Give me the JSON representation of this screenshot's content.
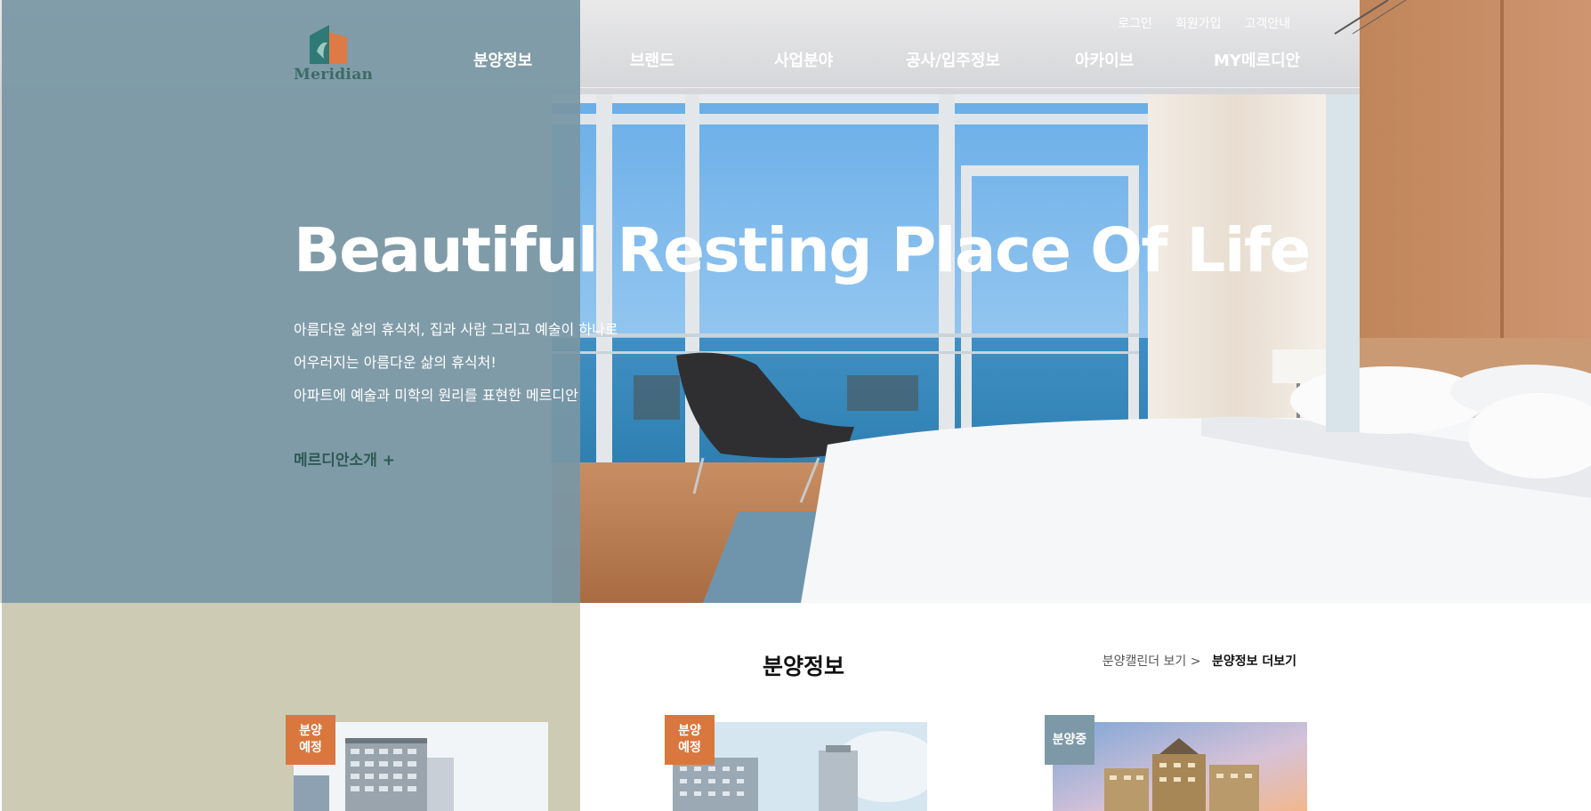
{
  "brand": {
    "logo_text": "Meridian"
  },
  "utility_nav": [
    {
      "label": "로그인"
    },
    {
      "label": "회원가입"
    },
    {
      "label": "고객안내"
    }
  ],
  "main_nav": [
    {
      "label": "분양정보"
    },
    {
      "label": "브랜드"
    },
    {
      "label": "사업분야"
    },
    {
      "label": "공사/입주정보"
    },
    {
      "label": "아카이브"
    },
    {
      "label": "MY메르디안"
    }
  ],
  "hero": {
    "title": "Beautiful Resting Place Of Life",
    "description": [
      "아름다운 삶의 휴식처, 집과 사람 그리고 예술이 하나로",
      "어우러지는 아름다운 삶의 휴식처!",
      "아파트에 예술과 미학의 원리를 표현한 메르디안"
    ],
    "cta": "메르디안소개 +"
  },
  "sale_section": {
    "title": "분양정보",
    "calendar_link": "분양캘린더 보기 >",
    "more_link": "분양정보 더보기",
    "cards": [
      {
        "badge": "분양\n예정",
        "badge_color": "#d9773f"
      },
      {
        "badge": "분양\n예정",
        "badge_color": "#d9773f"
      },
      {
        "badge": "분양중",
        "badge_color": "#7d99a7"
      }
    ]
  },
  "colors": {
    "hero_tint": "#7997a5",
    "bottom_left_bg": "#cdcbb4",
    "brand_green": "#2e5a54",
    "badge_orange": "#d9773f",
    "badge_gray": "#7d99a7"
  }
}
